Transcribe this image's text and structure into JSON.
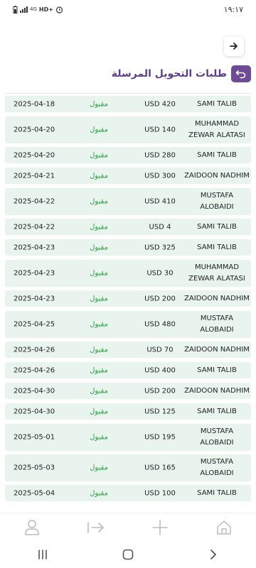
{
  "status_bar": {
    "time": "١٩:١٧",
    "network": "4G",
    "hd": "HD+",
    "icons": [
      "battery-icon",
      "signal-icon",
      "alarm-icon"
    ]
  },
  "header": {
    "title": "طلبات التحويل المرسلة",
    "back_icon": "return-arrow-icon",
    "forward_icon": "arrow-right-icon"
  },
  "colors": {
    "accent": "#6f4a95",
    "title": "#5c3f86",
    "row_bg": "#e9f4ef",
    "status_green": "#2ea043"
  },
  "transfers": [
    {
      "date": "2025-04-18",
      "status": "مقبول",
      "amount": "USD 420",
      "name": "SAMI TALIB"
    },
    {
      "date": "2025-04-20",
      "status": "مقبول",
      "amount": "USD 140",
      "name": "MUHAMMAD ZEWAR ALATASI"
    },
    {
      "date": "2025-04-20",
      "status": "مقبول",
      "amount": "USD 280",
      "name": "SAMI TALIB"
    },
    {
      "date": "2025-04-21",
      "status": "مقبول",
      "amount": "USD 300",
      "name": "ZAIDOON NADHIM"
    },
    {
      "date": "2025-04-22",
      "status": "مقبول",
      "amount": "USD 410",
      "name": "MUSTAFA ALOBAIDI"
    },
    {
      "date": "2025-04-22",
      "status": "مقبول",
      "amount": "USD 4",
      "name": "SAMI TALIB"
    },
    {
      "date": "2025-04-23",
      "status": "مقبول",
      "amount": "USD 325",
      "name": "SAMI TALIB"
    },
    {
      "date": "2025-04-23",
      "status": "مقبول",
      "amount": "USD 30",
      "name": "MUHAMMAD ZEWAR ALATASI"
    },
    {
      "date": "2025-04-23",
      "status": "مقبول",
      "amount": "USD 200",
      "name": "ZAIDOON NADHIM"
    },
    {
      "date": "2025-04-25",
      "status": "مقبول",
      "amount": "USD 480",
      "name": "MUSTAFA ALOBAIDI"
    },
    {
      "date": "2025-04-26",
      "status": "مقبول",
      "amount": "USD 70",
      "name": "ZAIDOON NADHIM"
    },
    {
      "date": "2025-04-26",
      "status": "مقبول",
      "amount": "USD 400",
      "name": "SAMI TALIB"
    },
    {
      "date": "2025-04-30",
      "status": "مقبول",
      "amount": "USD 200",
      "name": "ZAIDOON NADHIM"
    },
    {
      "date": "2025-04-30",
      "status": "مقبول",
      "amount": "USD 125",
      "name": "SAMI TALIB"
    },
    {
      "date": "2025-05-01",
      "status": "مقبول",
      "amount": "USD 195",
      "name": "MUSTAFA ALOBAIDI"
    },
    {
      "date": "2025-05-03",
      "status": "مقبول",
      "amount": "USD 165",
      "name": "MUSTAFA ALOBAIDI"
    },
    {
      "date": "2025-05-04",
      "status": "مقبول",
      "amount": "USD 100",
      "name": "SAMI TALIB"
    }
  ],
  "bottom_nav": [
    {
      "icon": "profile-icon"
    },
    {
      "icon": "transfer-icon"
    },
    {
      "icon": "add-icon"
    },
    {
      "icon": "home-icon"
    }
  ],
  "system_nav": [
    {
      "icon": "recents-icon"
    },
    {
      "icon": "home-circle-icon"
    },
    {
      "icon": "back-chevron-icon"
    }
  ]
}
